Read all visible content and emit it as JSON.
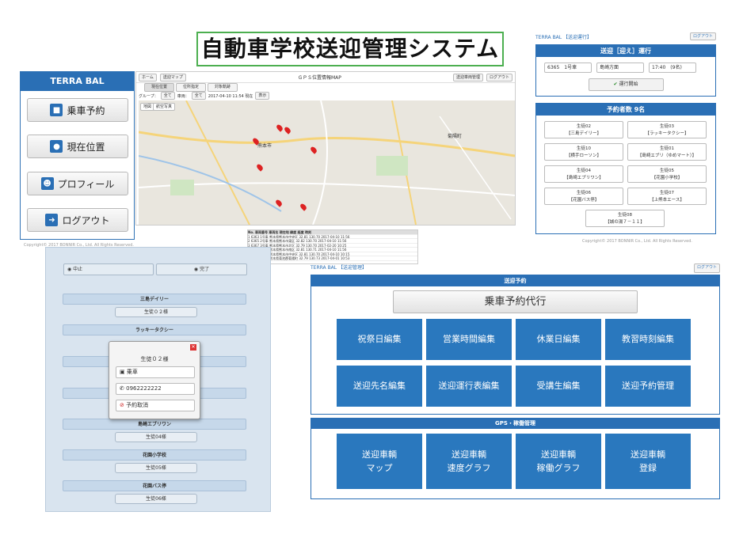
{
  "title": "自動車学校送迎管理システム",
  "left_panel": {
    "brand": "TERRA BAL",
    "buttons": [
      "乗車予約",
      "現在位置",
      "プロフィール",
      "ログアウト"
    ],
    "icons": [
      "bus-icon",
      "map-marker-icon",
      "users-icon",
      "logout-icon"
    ],
    "copyright": "Copyright© 2017 BONNIR Co., Ltd. All Rights Reserved."
  },
  "map_panel": {
    "home": "ホーム",
    "tab_a": "送迎マップ",
    "heading": "ＧＰＳ位置情報MAP",
    "btn_a": "送迎車両管理",
    "btn_b": "ログアウト",
    "tabs": [
      "現在位置",
      "位所指定",
      "対象軌跡"
    ],
    "filter_group": "グループ：",
    "filter_group_val": "全て",
    "filter_car": "車両：",
    "filter_car_val": "全て",
    "datetime": "2017-04-10 11:54 現在",
    "show_btn": "表示",
    "map_types": [
      "地図",
      "航空写真"
    ],
    "map_labels": [
      "熊本市",
      "菊陽町"
    ]
  },
  "gps_table": {
    "header": "No. 車両番号 車両名 現在地 緯度 経度 時刻",
    "rows": [
      "1 6363 1号車 熊本県熊本市中央区 32.81 130.70 2017-04-10 11:56",
      "2 6365 2号車 熊本県熊本市東区 32.82 130.70 2017-04-10 11:56",
      "3 6367 3号車 熊本県熊本市北区 32.79 130.70 2017-02-20 10:25",
      "4 6368 4号車 熊本県熊本市南区 32.81 130.71 2017-04-10 11:56",
      "5 6369 5号車 熊本県熊本市中央区 32.81 130.70 2017-04-10 10:15",
      "6 6370 6号車 熊本県菊池郡菊陽町 32.79 130.73 2017-04-01 10:53"
    ]
  },
  "route_panel": {
    "brand": "TERRA BAL 【送迎運行】",
    "logout": "ログアウト",
    "header": "送迎［迎え］運行",
    "car": "6365　1号車",
    "direction": "島崎方面",
    "time": "17:40　(9名)",
    "start_btn": "運行開始",
    "count_header": "予約者数 9名",
    "riders": [
      [
        "生徒02",
        "【三島デイリー】"
      ],
      [
        "生徒03",
        "【ラッキータクシー】"
      ],
      [
        "生徒10",
        "【横手ローソン】"
      ],
      [
        "生徒01",
        "【島崎エブリ（ゆめマート）】"
      ],
      [
        "生徒04",
        "【島崎エブリワン】"
      ],
      [
        "生徒05",
        "【花園小学校】"
      ],
      [
        "生徒06",
        "【花園バス停】"
      ],
      [
        "生徒07",
        "【上熊本エース】"
      ],
      [
        "生徒08",
        "【城の湯７－１１】"
      ]
    ],
    "copyright": "Copyright© 2017 BONNIR Co., Ltd. All Rights Reserved."
  },
  "mobile": {
    "stop": "中止",
    "done": "完了",
    "sections": [
      "三島デイリー",
      "ラッキータクシー",
      "島崎エブリワン",
      "花園小学校",
      "花園バス停"
    ],
    "buttons": [
      "生徒０２様",
      "生徒04様",
      "生徒05様",
      "生徒06様"
    ],
    "popup_title": "生徒０２様",
    "popup_board": "乗車",
    "popup_phone": "0962222222",
    "popup_cancel": "予約取消"
  },
  "admin": {
    "brand": "TERRA BAL 【送迎管理】",
    "logout": "ログアウト",
    "section1": "送迎予約",
    "proxy_btn": "乗車予約代行",
    "tiles": [
      "祝祭日編集",
      "営業時間編集",
      "休業日編集",
      "教習時刻編集",
      "送迎先名編集",
      "送迎運行表編集",
      "受講生編集",
      "送迎予約管理"
    ],
    "section2": "GPS・稼働管理",
    "gps_tiles": [
      "送迎車輌\nマップ",
      "送迎車輌\n速度グラフ",
      "送迎車輌\n稼働グラフ",
      "送迎車輌\n登録"
    ]
  },
  "colors": {
    "primary": "#2a6fb5",
    "tile": "#2a78be",
    "title_border": "#4caf50"
  }
}
